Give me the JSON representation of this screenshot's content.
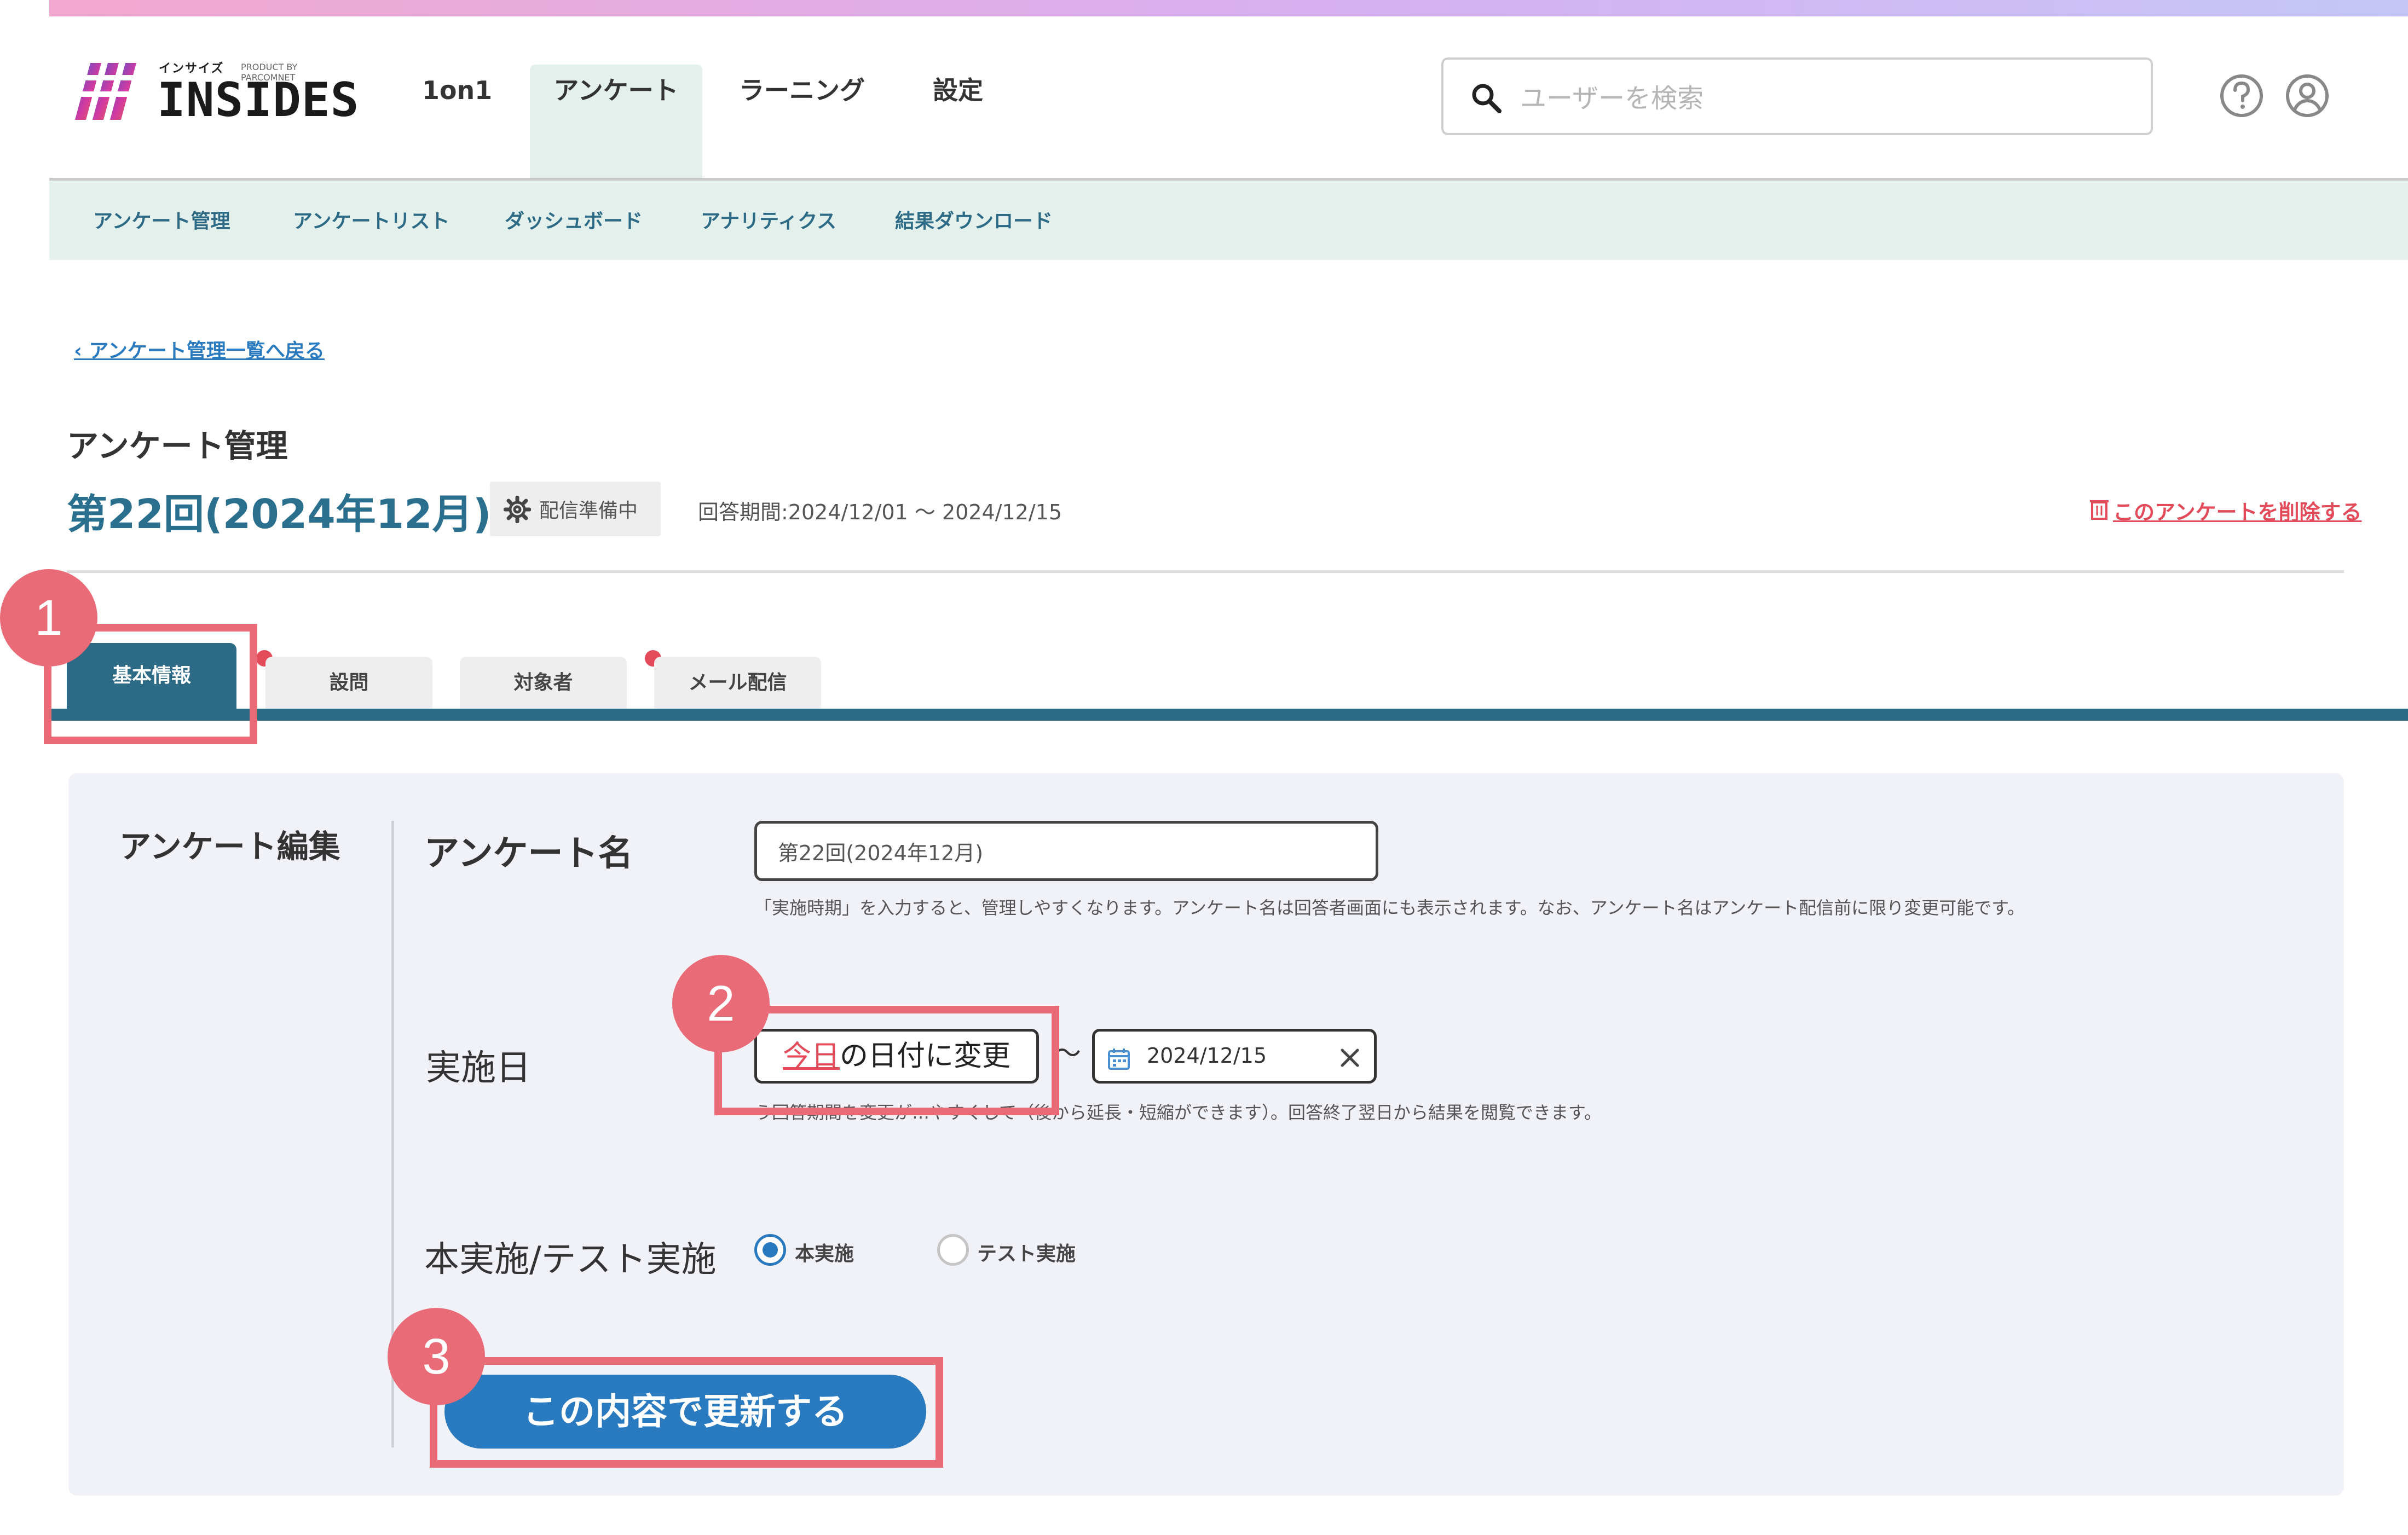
{
  "brand": {
    "logo_small": "インサイズ",
    "logo_tag": "PRODUCT BY PARCOMNET",
    "logo_text": "INSIDES"
  },
  "nav": {
    "items": [
      {
        "label": "1on1"
      },
      {
        "label": "アンケート",
        "active": true
      },
      {
        "label": "ラーニング"
      },
      {
        "label": "設定"
      }
    ]
  },
  "search": {
    "placeholder": "ユーザーを検索"
  },
  "header_icons": [
    "help-circle-icon",
    "user-circle-icon"
  ],
  "subnav": {
    "items": [
      {
        "label": "アンケート管理"
      },
      {
        "label": "アンケートリスト"
      },
      {
        "label": "ダッシュボード"
      },
      {
        "label": "アナリティクス"
      },
      {
        "label": "結果ダウンロード"
      }
    ]
  },
  "back_link": "‹ アンケート管理一覧へ戻る",
  "page": {
    "section_title": "アンケート管理",
    "survey_title": "第22回(2024年12月)",
    "status": "配信準備中",
    "period": "回答期間:2024/12/01 ～ 2024/12/15",
    "delete_link": "このアンケートを削除する"
  },
  "tabs": [
    {
      "label": "基本情報",
      "active": true,
      "alert": true
    },
    {
      "label": "設問"
    },
    {
      "label": "対象者"
    },
    {
      "label": "メール配信",
      "alert": true
    }
  ],
  "form": {
    "panel_title": "アンケート編集",
    "name_label": "アンケート名",
    "name_value": "第22回(2024年12月)",
    "name_hint": "「実施時期」を入力すると、管理しやすくなります。アンケート名は回答者画面にも表示されます。なお、アンケート名はアンケート配信前に限り変更可能です。",
    "date_label": "実施日",
    "today_red": "今日",
    "today_rest": "の日付に変更",
    "tilde": "～",
    "end_date": "2024/12/15",
    "date_hint": "う回答期間を変更が…やすくして（後から延長・短縮ができます）。回答終了翌日から結果を閲覧できます。",
    "mode_label": "本実施/テスト実施",
    "mode_options": [
      {
        "label": "本実施",
        "selected": true
      },
      {
        "label": "テスト実施",
        "selected": false
      }
    ],
    "submit_label": "この内容で更新する"
  },
  "annotations": {
    "markers": [
      "1",
      "2",
      "3"
    ],
    "color": "#ea6b78"
  },
  "colors": {
    "accent": "#2c6a86",
    "primary_button": "#2a7ac0",
    "danger": "#e34b5a",
    "subnav_bg": "#e3f0ec"
  }
}
